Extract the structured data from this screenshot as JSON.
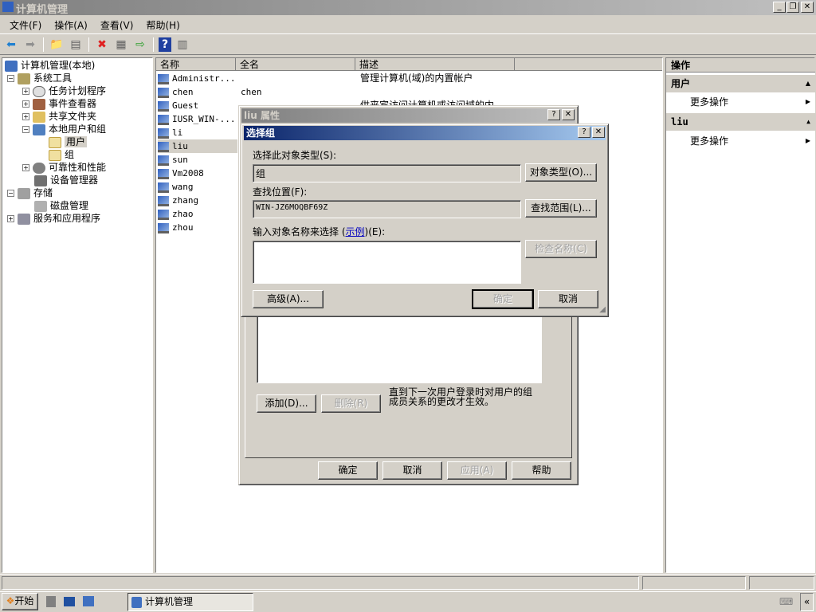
{
  "window": {
    "title": "计算机管理"
  },
  "menu": [
    "文件(F)",
    "操作(A)",
    "查看(V)",
    "帮助(H)"
  ],
  "tree": {
    "root": "计算机管理(本地)",
    "system_tools": "系统工具",
    "task_scheduler": "任务计划程序",
    "event_viewer": "事件查看器",
    "shared_folders": "共享文件夹",
    "local_users": "本地用户和组",
    "users": "用户",
    "groups": "组",
    "reliability": "可靠性和性能",
    "device_manager": "设备管理器",
    "storage": "存储",
    "disk_mgmt": "磁盘管理",
    "services_apps": "服务和应用程序"
  },
  "list": {
    "headers": [
      "名称",
      "全名",
      "描述"
    ],
    "rows": [
      {
        "name": "Administr...",
        "full": "",
        "desc": "管理计算机(域)的内置帐户"
      },
      {
        "name": "chen",
        "full": "chen",
        "desc": ""
      },
      {
        "name": "Guest",
        "full": "",
        "desc": "供来宾访问计算机或访问域的内..."
      },
      {
        "name": "IUSR_WIN-...",
        "full": "",
        "desc": ""
      },
      {
        "name": "li",
        "full": "",
        "desc": ""
      },
      {
        "name": "liu",
        "full": "",
        "desc": ""
      },
      {
        "name": "sun",
        "full": "",
        "desc": ""
      },
      {
        "name": "Vm2008",
        "full": "",
        "desc": ""
      },
      {
        "name": "wang",
        "full": "",
        "desc": ""
      },
      {
        "name": "zhang",
        "full": "",
        "desc": ""
      },
      {
        "name": "zhao",
        "full": "",
        "desc": ""
      },
      {
        "name": "zhou",
        "full": "",
        "desc": ""
      }
    ]
  },
  "actions": {
    "title": "操作",
    "section1": "用户",
    "more1": "更多操作",
    "section2": "liu",
    "more2": "更多操作"
  },
  "props": {
    "title": "liu 属性",
    "add": "添加(D)...",
    "remove": "删除(R)",
    "note": "直到下一次用户登录时对用户的组成员关系的更改才生效。",
    "ok": "确定",
    "cancel": "取消",
    "apply": "应用(A)",
    "help": "帮助"
  },
  "select": {
    "title": "选择组",
    "type_label": "选择此对象类型(S):",
    "type_value": "组",
    "type_btn": "对象类型(O)...",
    "loc_label": "查找位置(F):",
    "loc_value": "WIN-JZ6MOQBF69Z",
    "loc_btn": "查找范围(L)...",
    "name_label_pre": "输入对象名称来选择 (",
    "name_link": "示例",
    "name_label_post": ")(E):",
    "name_value": "",
    "check_btn": "检查名称(C)",
    "advanced": "高级(A)...",
    "ok": "确定",
    "cancel": "取消"
  },
  "taskbar": {
    "start": "开始",
    "task": "计算机管理"
  }
}
